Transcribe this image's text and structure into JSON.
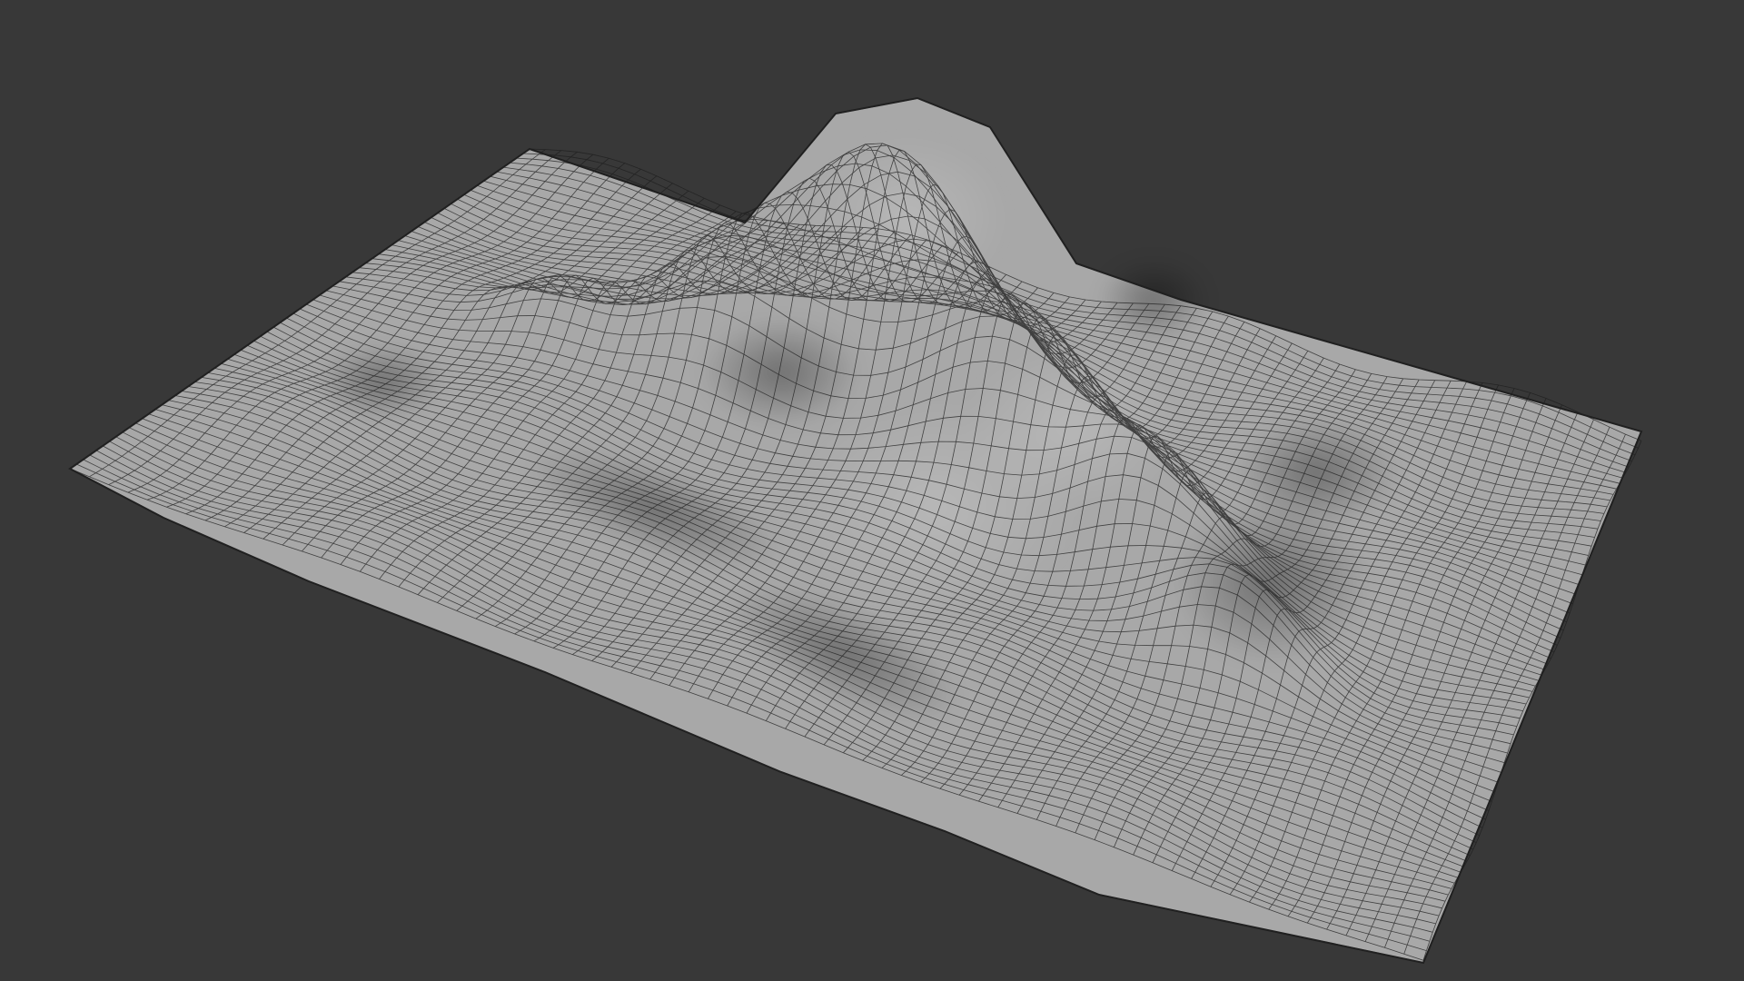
{
  "scene": {
    "background_color": "#383838",
    "mesh_color": "#a7a7a7",
    "wire_color": "#1e1e1e",
    "object": "terrain-mesh",
    "shading": "solid-wireframe"
  }
}
